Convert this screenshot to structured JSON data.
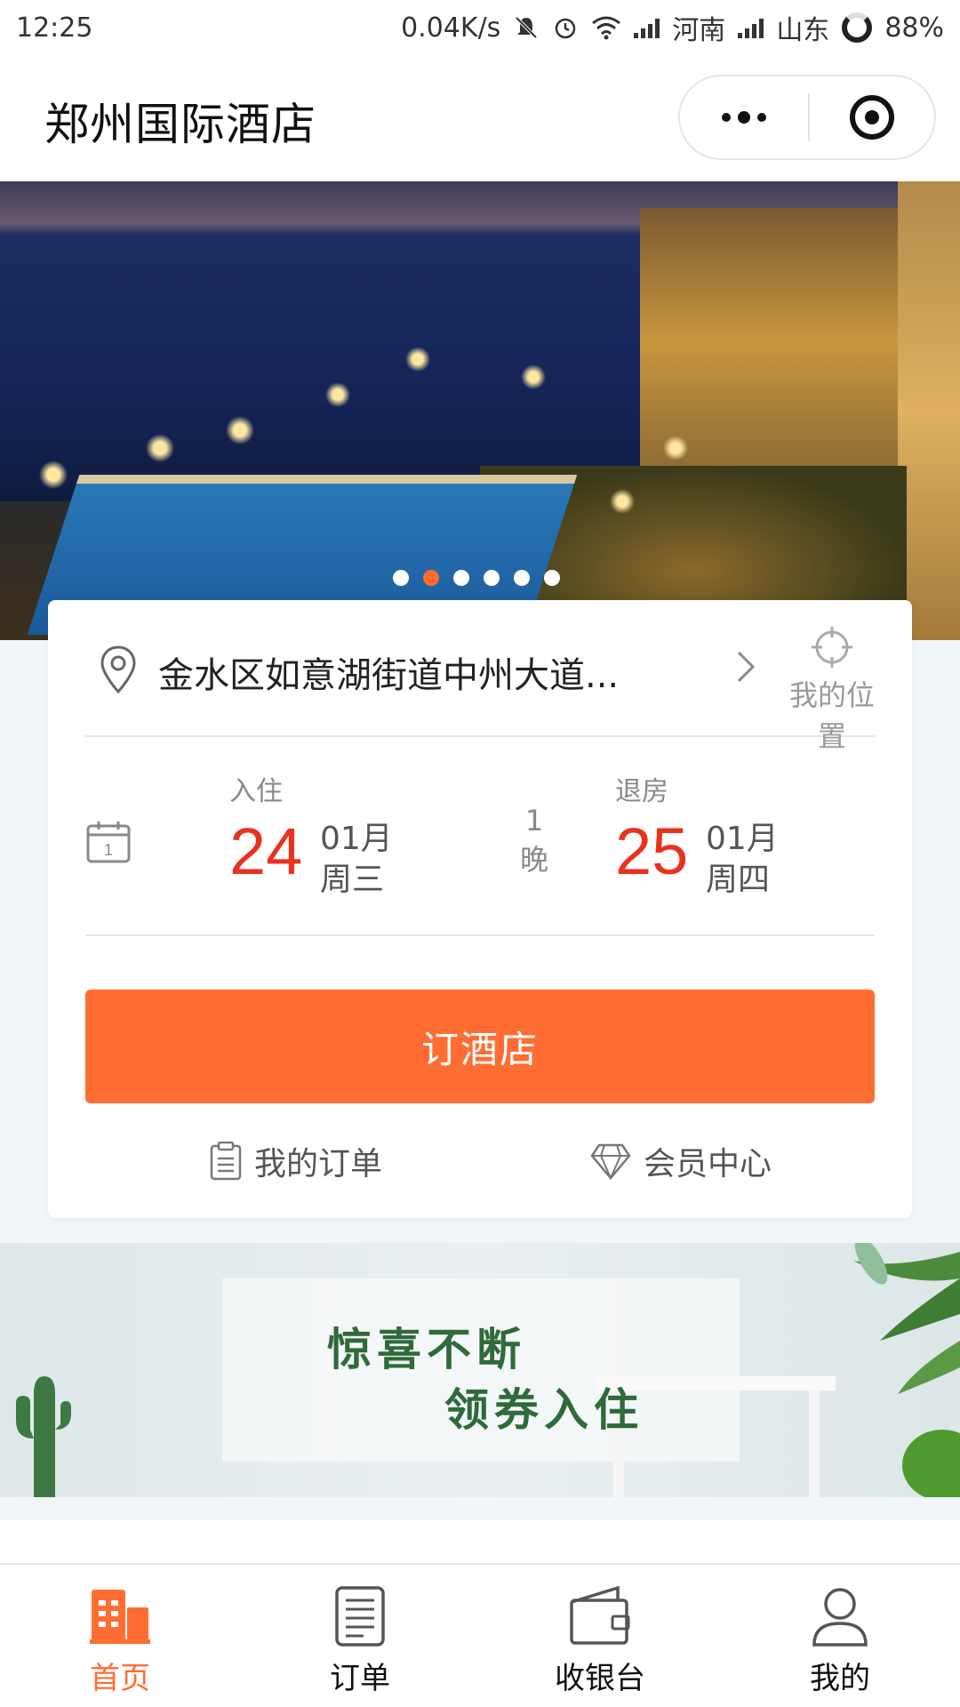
{
  "status_bar": {
    "time": "12:25",
    "speed": "0.04K/s",
    "carrier1": "河南",
    "carrier2": "山东",
    "battery": "88%"
  },
  "header": {
    "title": "郑州国际酒店"
  },
  "banner": {
    "slide_count": 6,
    "active_slide": 2
  },
  "booking": {
    "address": "金水区如意湖街道中州大道...",
    "my_location_label": "我的位置",
    "checkin": {
      "label": "入住",
      "day": "24",
      "month": "01月",
      "weekday": "周三"
    },
    "nights": {
      "count": "1",
      "unit": "晚"
    },
    "checkout": {
      "label": "退房",
      "day": "25",
      "month": "01月",
      "weekday": "周四"
    },
    "book_button": "订酒店",
    "my_orders": "我的订单",
    "member_center": "会员中心"
  },
  "promo": {
    "line1": "惊喜不断",
    "line2": "领券入住"
  },
  "tabs": [
    {
      "label": "首页",
      "icon": "building-icon",
      "active": true
    },
    {
      "label": "订单",
      "icon": "list-icon",
      "active": false
    },
    {
      "label": "收银台",
      "icon": "wallet-icon",
      "active": false
    },
    {
      "label": "我的",
      "icon": "user-icon",
      "active": false
    }
  ],
  "colors": {
    "accent": "#ff6d33",
    "date_red": "#e8321e",
    "promo_green": "#2f6a3a"
  }
}
